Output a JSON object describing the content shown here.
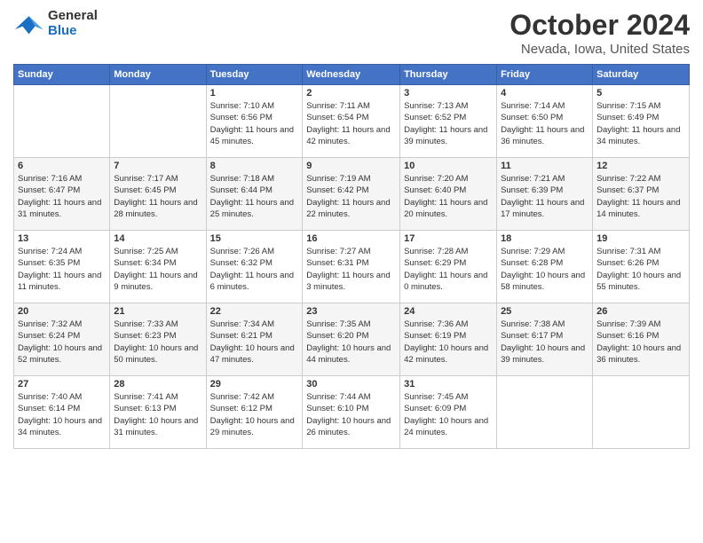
{
  "header": {
    "logo_general": "General",
    "logo_blue": "Blue",
    "month": "October 2024",
    "location": "Nevada, Iowa, United States"
  },
  "weekdays": [
    "Sunday",
    "Monday",
    "Tuesday",
    "Wednesday",
    "Thursday",
    "Friday",
    "Saturday"
  ],
  "weeks": [
    [
      {
        "day": "",
        "info": ""
      },
      {
        "day": "",
        "info": ""
      },
      {
        "day": "1",
        "info": "Sunrise: 7:10 AM\nSunset: 6:56 PM\nDaylight: 11 hours and 45 minutes."
      },
      {
        "day": "2",
        "info": "Sunrise: 7:11 AM\nSunset: 6:54 PM\nDaylight: 11 hours and 42 minutes."
      },
      {
        "day": "3",
        "info": "Sunrise: 7:13 AM\nSunset: 6:52 PM\nDaylight: 11 hours and 39 minutes."
      },
      {
        "day": "4",
        "info": "Sunrise: 7:14 AM\nSunset: 6:50 PM\nDaylight: 11 hours and 36 minutes."
      },
      {
        "day": "5",
        "info": "Sunrise: 7:15 AM\nSunset: 6:49 PM\nDaylight: 11 hours and 34 minutes."
      }
    ],
    [
      {
        "day": "6",
        "info": "Sunrise: 7:16 AM\nSunset: 6:47 PM\nDaylight: 11 hours and 31 minutes."
      },
      {
        "day": "7",
        "info": "Sunrise: 7:17 AM\nSunset: 6:45 PM\nDaylight: 11 hours and 28 minutes."
      },
      {
        "day": "8",
        "info": "Sunrise: 7:18 AM\nSunset: 6:44 PM\nDaylight: 11 hours and 25 minutes."
      },
      {
        "day": "9",
        "info": "Sunrise: 7:19 AM\nSunset: 6:42 PM\nDaylight: 11 hours and 22 minutes."
      },
      {
        "day": "10",
        "info": "Sunrise: 7:20 AM\nSunset: 6:40 PM\nDaylight: 11 hours and 20 minutes."
      },
      {
        "day": "11",
        "info": "Sunrise: 7:21 AM\nSunset: 6:39 PM\nDaylight: 11 hours and 17 minutes."
      },
      {
        "day": "12",
        "info": "Sunrise: 7:22 AM\nSunset: 6:37 PM\nDaylight: 11 hours and 14 minutes."
      }
    ],
    [
      {
        "day": "13",
        "info": "Sunrise: 7:24 AM\nSunset: 6:35 PM\nDaylight: 11 hours and 11 minutes."
      },
      {
        "day": "14",
        "info": "Sunrise: 7:25 AM\nSunset: 6:34 PM\nDaylight: 11 hours and 9 minutes."
      },
      {
        "day": "15",
        "info": "Sunrise: 7:26 AM\nSunset: 6:32 PM\nDaylight: 11 hours and 6 minutes."
      },
      {
        "day": "16",
        "info": "Sunrise: 7:27 AM\nSunset: 6:31 PM\nDaylight: 11 hours and 3 minutes."
      },
      {
        "day": "17",
        "info": "Sunrise: 7:28 AM\nSunset: 6:29 PM\nDaylight: 11 hours and 0 minutes."
      },
      {
        "day": "18",
        "info": "Sunrise: 7:29 AM\nSunset: 6:28 PM\nDaylight: 10 hours and 58 minutes."
      },
      {
        "day": "19",
        "info": "Sunrise: 7:31 AM\nSunset: 6:26 PM\nDaylight: 10 hours and 55 minutes."
      }
    ],
    [
      {
        "day": "20",
        "info": "Sunrise: 7:32 AM\nSunset: 6:24 PM\nDaylight: 10 hours and 52 minutes."
      },
      {
        "day": "21",
        "info": "Sunrise: 7:33 AM\nSunset: 6:23 PM\nDaylight: 10 hours and 50 minutes."
      },
      {
        "day": "22",
        "info": "Sunrise: 7:34 AM\nSunset: 6:21 PM\nDaylight: 10 hours and 47 minutes."
      },
      {
        "day": "23",
        "info": "Sunrise: 7:35 AM\nSunset: 6:20 PM\nDaylight: 10 hours and 44 minutes."
      },
      {
        "day": "24",
        "info": "Sunrise: 7:36 AM\nSunset: 6:19 PM\nDaylight: 10 hours and 42 minutes."
      },
      {
        "day": "25",
        "info": "Sunrise: 7:38 AM\nSunset: 6:17 PM\nDaylight: 10 hours and 39 minutes."
      },
      {
        "day": "26",
        "info": "Sunrise: 7:39 AM\nSunset: 6:16 PM\nDaylight: 10 hours and 36 minutes."
      }
    ],
    [
      {
        "day": "27",
        "info": "Sunrise: 7:40 AM\nSunset: 6:14 PM\nDaylight: 10 hours and 34 minutes."
      },
      {
        "day": "28",
        "info": "Sunrise: 7:41 AM\nSunset: 6:13 PM\nDaylight: 10 hours and 31 minutes."
      },
      {
        "day": "29",
        "info": "Sunrise: 7:42 AM\nSunset: 6:12 PM\nDaylight: 10 hours and 29 minutes."
      },
      {
        "day": "30",
        "info": "Sunrise: 7:44 AM\nSunset: 6:10 PM\nDaylight: 10 hours and 26 minutes."
      },
      {
        "day": "31",
        "info": "Sunrise: 7:45 AM\nSunset: 6:09 PM\nDaylight: 10 hours and 24 minutes."
      },
      {
        "day": "",
        "info": ""
      },
      {
        "day": "",
        "info": ""
      }
    ]
  ]
}
